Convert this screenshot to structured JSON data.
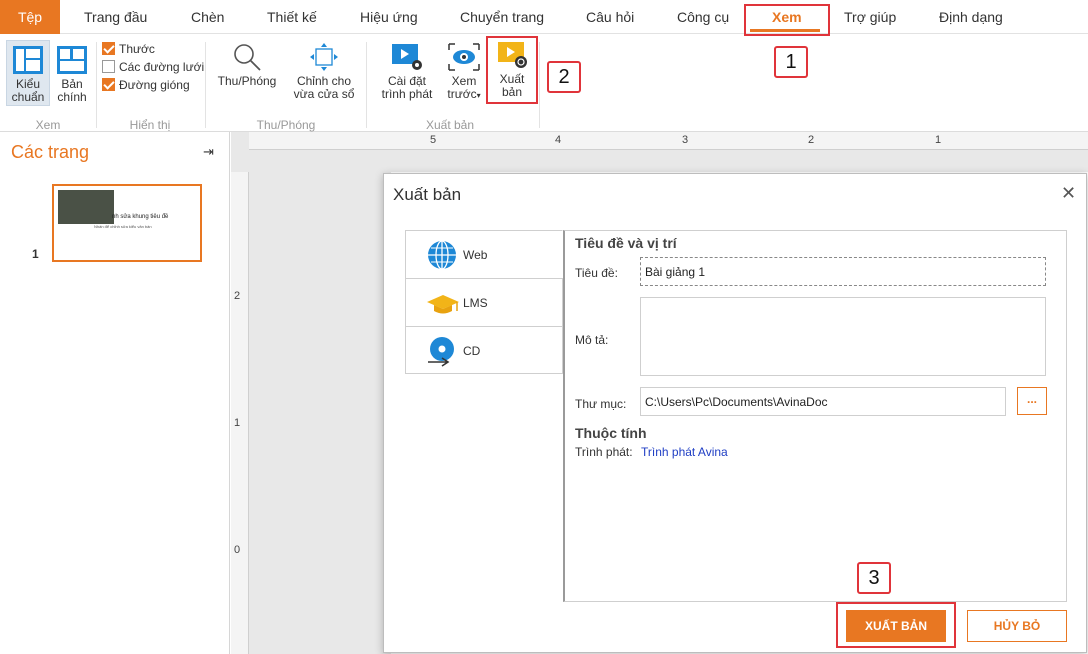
{
  "menu": {
    "file": "Tệp",
    "items": [
      "Trang đầu",
      "Chèn",
      "Thiết kế",
      "Hiệu ứng",
      "Chuyển trang",
      "Câu hỏi",
      "Công cụ",
      "Xem",
      "Trợ giúp",
      "Định dạng"
    ],
    "active": "Xem"
  },
  "ribbon": {
    "view": {
      "normal": [
        "Kiểu",
        "chuẩn"
      ],
      "master": [
        "Bản",
        "chính"
      ],
      "label": "Xem"
    },
    "show": {
      "ruler": "Thước",
      "grid": "Các đường lưới",
      "guides": "Đường gióng",
      "label": "Hiển thị"
    },
    "zoom": {
      "zoom": "Thu/Phóng",
      "fit": [
        "Chỉnh cho",
        "vừa cửa sổ"
      ],
      "label": "Thu/Phóng"
    },
    "publish": {
      "player_settings": [
        "Cài đặt",
        "trình phát"
      ],
      "preview": [
        "Xem",
        "trước"
      ],
      "publish": [
        "Xuất",
        "bản"
      ],
      "label": "Xuất bản"
    }
  },
  "pages": {
    "title": "Các trang",
    "thumb_title": "nh sửa khung tiêu đề",
    "thumb_subtitle": "Nhấn để chỉnh sửa kiểu văn bản",
    "number": "1"
  },
  "ruler": {
    "h": [
      "5",
      "4",
      "3",
      "2",
      "1"
    ],
    "v": [
      "2",
      "1",
      "0"
    ]
  },
  "dialog": {
    "title": "Xuất bản",
    "tabs": [
      "Web",
      "LMS",
      "CD"
    ],
    "section_title": "Tiêu đề và vị trí",
    "title_label": "Tiêu đề:",
    "title_value": "Bài giảng 1",
    "desc_label": "Mô tả:",
    "desc_value": "",
    "folder_label": "Thư mục:",
    "folder_value": "C:\\Users\\Pc\\Documents\\AvinaDoc",
    "browse": "...",
    "props_title": "Thuộc tính",
    "player_label": "Trình phát:",
    "player_value": "Trình phát Avina",
    "publish_button": "XUẤT BẢN",
    "cancel_button": "HỦY BỎ"
  },
  "callouts": [
    "1",
    "2",
    "3"
  ],
  "colors": {
    "accent": "#e87722",
    "callout": "#e0343a",
    "link": "#1f3ec4"
  }
}
